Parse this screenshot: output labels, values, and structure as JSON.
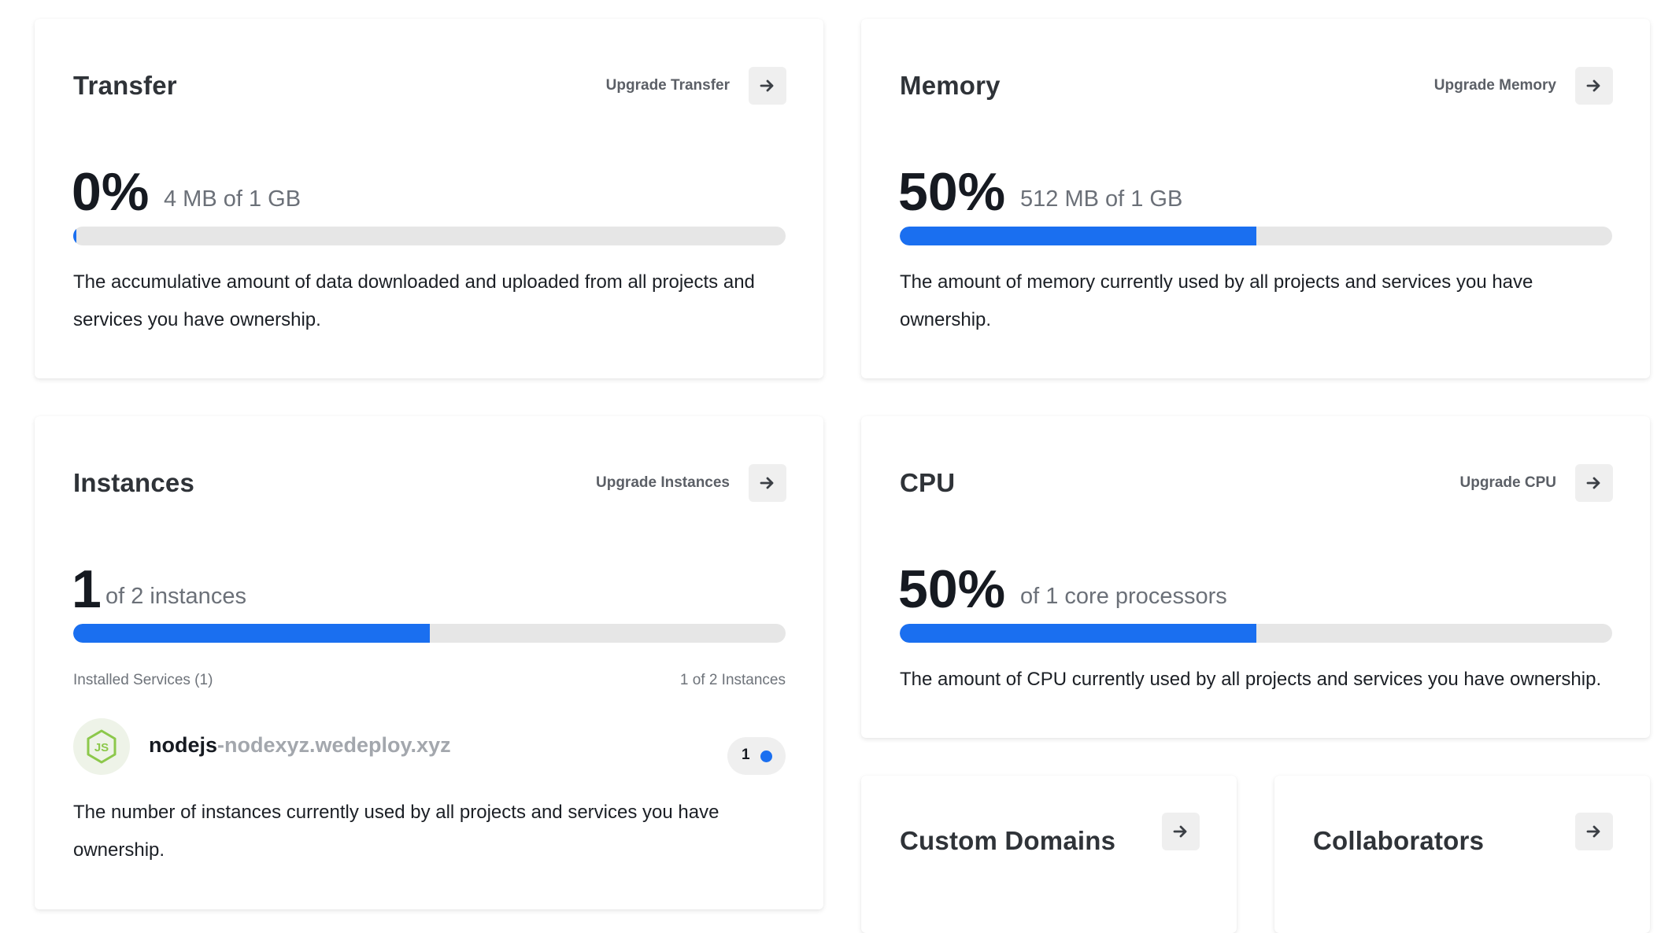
{
  "colors": {
    "accent": "#1a6ff0",
    "bar_track": "#e6e6e6",
    "button_bg": "#efefef",
    "nodejs_green": "#8cc84b"
  },
  "transfer": {
    "title": "Transfer",
    "upgrade_label": "Upgrade Transfer",
    "percent_text": "0%",
    "detail": "4 MB of 1 GB",
    "progress": 0.0,
    "description": "The accumulative amount of data downloaded and uploaded from all projects and services you have ownership.",
    "arrow_icon": "arrow-right-icon"
  },
  "memory": {
    "title": "Memory",
    "upgrade_label": "Upgrade Memory",
    "percent_text": "50%",
    "detail": "512 MB of 1 GB",
    "progress": 0.5,
    "description": "The amount of memory currently used by all projects and services you have ownership.",
    "arrow_icon": "arrow-right-icon"
  },
  "instances": {
    "title": "Instances",
    "upgrade_label": "Upgrade Instances",
    "count_text": "1",
    "detail": "of 2 instances",
    "progress": 0.5,
    "installed_label": "Installed Services (1)",
    "instances_label": "1 of 2 Instances",
    "service": {
      "icon": "nodejs-icon",
      "name": "nodejs",
      "domain": "-nodexyz.wedeploy.xyz",
      "instance_count": "1"
    },
    "description": "The number of instances currently used by all projects and services you have ownership.",
    "arrow_icon": "arrow-right-icon"
  },
  "cpu": {
    "title": "CPU",
    "upgrade_label": "Upgrade CPU",
    "percent_text": "50%",
    "detail": "of 1 core processors",
    "progress": 0.5,
    "description": "The amount of CPU currently used by all projects and services you have ownership.",
    "arrow_icon": "arrow-right-icon"
  },
  "custom_domains": {
    "title": "Custom Domains",
    "arrow_icon": "arrow-right-icon"
  },
  "collaborators": {
    "title": "Collaborators",
    "arrow_icon": "arrow-right-icon"
  }
}
